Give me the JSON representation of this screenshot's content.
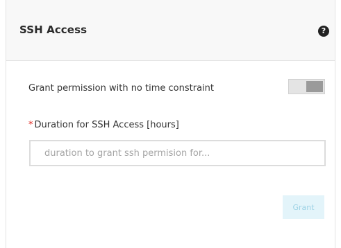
{
  "header": {
    "title": "SSH Access",
    "help_icon": "question-circle-icon",
    "help_glyph": "?"
  },
  "no_time_constraint": {
    "label": "Grant permission with no time constraint",
    "enabled": false
  },
  "duration": {
    "required_marker": "*",
    "label": "Duration for SSH Access [hours]",
    "value": "",
    "placeholder": "duration to grant ssh permision for..."
  },
  "actions": {
    "grant_label": "Grant",
    "grant_disabled": true
  },
  "colors": {
    "required": "#e0231c",
    "grant_button_bg": "#e3f4fa",
    "grant_button_text": "#9fd3e6"
  }
}
